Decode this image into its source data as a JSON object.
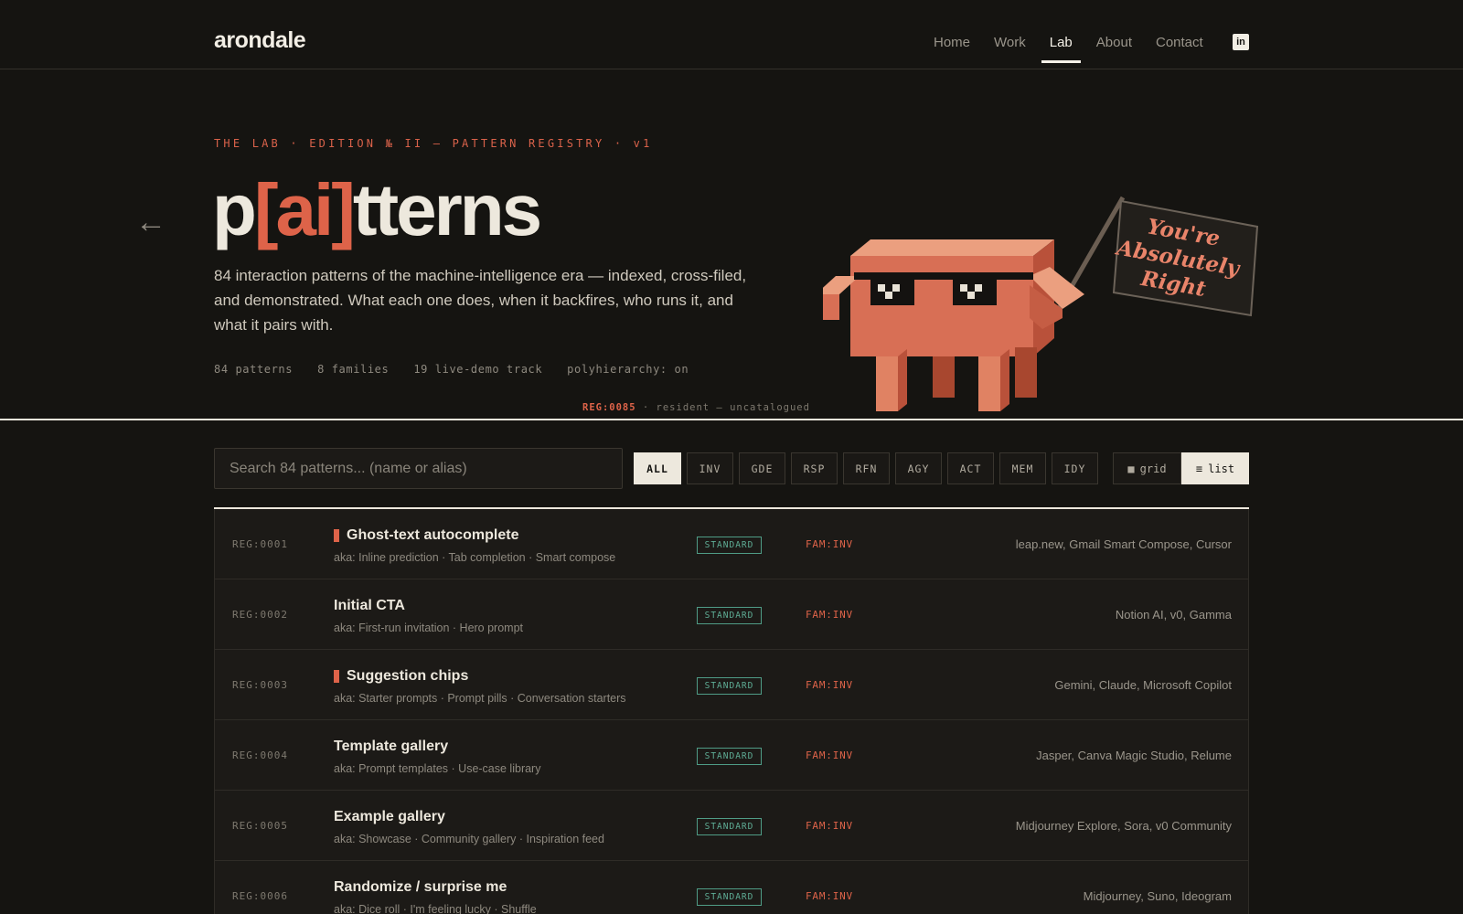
{
  "brand": {
    "logo": "arondale"
  },
  "nav": {
    "links": [
      "Home",
      "Work",
      "Lab",
      "About",
      "Contact"
    ],
    "active": "Lab",
    "social_icon": "linkedin-icon",
    "social_label": "in"
  },
  "hero": {
    "back_arrow": "←",
    "eyebrow": "THE LAB · EDITION № II — PATTERN REGISTRY · v1",
    "title_pre": "p",
    "title_accent": "[ai]",
    "title_post": "tterns",
    "description": "84 interaction patterns of the machine-intelligence era — indexed, cross-filed, and demonstrated. What each one does, when it backfires, who runs it, and what it pairs with.",
    "stats": [
      "84 patterns",
      "8 families",
      "19 live-demo track",
      "polyhierarchy: on"
    ],
    "mascot": {
      "icon": "pixel-crab-mascot",
      "flag_text": [
        "You're",
        "Absolutely",
        "Right"
      ],
      "caption_id": "REG:0085",
      "caption_text": " · resident — uncatalogued"
    }
  },
  "toolbar": {
    "search_placeholder": "Search 84 patterns... (name or alias)",
    "filters": [
      "ALL",
      "INV",
      "GDE",
      "RSP",
      "RFN",
      "AGY",
      "ACT",
      "MEM",
      "IDY"
    ],
    "active_filter": "ALL",
    "view_toggle": {
      "grid_label": "grid",
      "grid_icon": "■",
      "list_label": "list",
      "list_icon": "≡",
      "active": "list"
    }
  },
  "patterns": [
    {
      "reg": "REG:0001",
      "name": "Ghost-text autocomplete",
      "live_demo": true,
      "aka": "aka: Inline prediction · Tab completion · Smart compose",
      "status": "STANDARD",
      "family": "FAM:INV",
      "products": "leap.new, Gmail Smart Compose, Cursor"
    },
    {
      "reg": "REG:0002",
      "name": "Initial CTA",
      "live_demo": false,
      "aka": "aka: First-run invitation · Hero prompt",
      "status": "STANDARD",
      "family": "FAM:INV",
      "products": "Notion AI, v0, Gamma"
    },
    {
      "reg": "REG:0003",
      "name": "Suggestion chips",
      "live_demo": true,
      "aka": "aka: Starter prompts · Prompt pills · Conversation starters",
      "status": "STANDARD",
      "family": "FAM:INV",
      "products": "Gemini, Claude, Microsoft Copilot"
    },
    {
      "reg": "REG:0004",
      "name": "Template gallery",
      "live_demo": false,
      "aka": "aka: Prompt templates · Use-case library",
      "status": "STANDARD",
      "family": "FAM:INV",
      "products": "Jasper, Canva Magic Studio, Relume"
    },
    {
      "reg": "REG:0005",
      "name": "Example gallery",
      "live_demo": false,
      "aka": "aka: Showcase · Community gallery · Inspiration feed",
      "status": "STANDARD",
      "family": "FAM:INV",
      "products": "Midjourney Explore, Sora, v0 Community"
    },
    {
      "reg": "REG:0006",
      "name": "Randomize / surprise me",
      "live_demo": false,
      "aka": "aka: Dice roll · I'm feeling lucky · Shuffle",
      "status": "STANDARD",
      "family": "FAM:INV",
      "products": "Midjourney, Suno, Ideogram"
    }
  ],
  "colors": {
    "background": "#151411",
    "accent": "#de6349",
    "standard_badge": "#5fae96",
    "text": "#ede8dd"
  }
}
